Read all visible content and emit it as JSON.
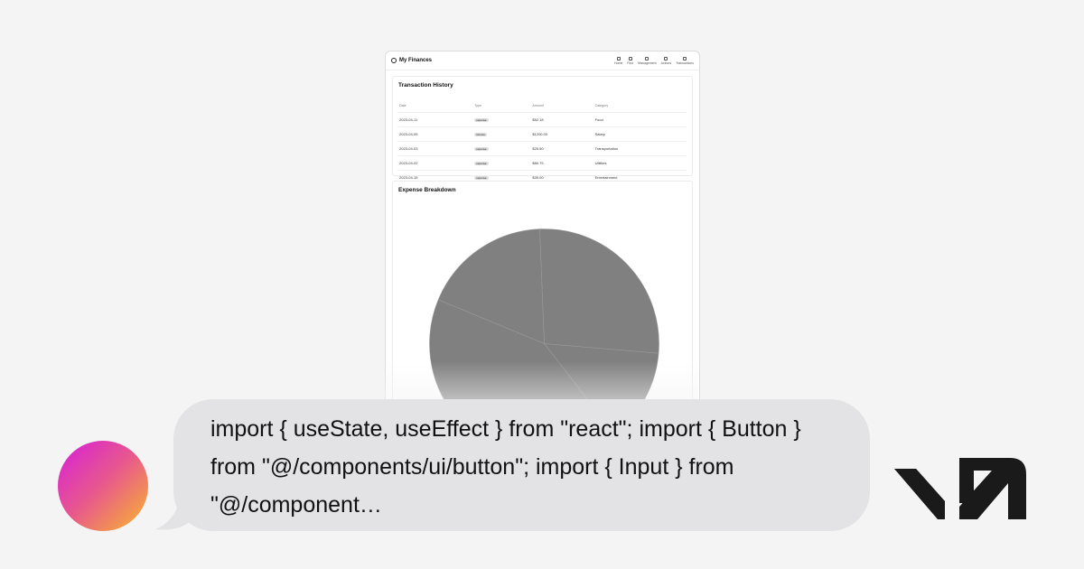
{
  "preview": {
    "app_title": "My Finances",
    "nav": [
      "Home",
      "Find",
      "Management",
      "Actions",
      "Transactions"
    ],
    "transactions": {
      "title": "Transaction History",
      "columns": [
        "Date",
        "Type",
        "Amount",
        "Category"
      ],
      "rows": [
        {
          "date": "2023-04-11",
          "type": "expense",
          "amount": "$52.18",
          "category": "Food"
        },
        {
          "date": "2023-04-05",
          "type": "income",
          "amount": "$1200.00",
          "category": "Salary"
        },
        {
          "date": "2023-04-03",
          "type": "expense",
          "amount": "$25.50",
          "category": "Transportation"
        },
        {
          "date": "2023-04-02",
          "type": "expense",
          "amount": "$80.75",
          "category": "Utilities"
        },
        {
          "date": "2023-04-15",
          "type": "expense",
          "amount": "$35.00",
          "category": "Entertainment"
        }
      ]
    },
    "breakdown": {
      "title": "Expense Breakdown"
    }
  },
  "chart_data": {
    "type": "pie",
    "categories": [
      "Food",
      "Transportation",
      "Utilities",
      "Entertainment"
    ],
    "values": [
      52.18,
      25.5,
      80.75,
      35.0
    ],
    "color": "#808080"
  },
  "message": {
    "text": "import { useState, useEffect } from \"react\"; import { Button } from \"@/components/ui/button\";  import { Input } from \"@/component…"
  },
  "colors": {
    "background": "#f4f4f4",
    "bubble": "#e3e3e5"
  }
}
